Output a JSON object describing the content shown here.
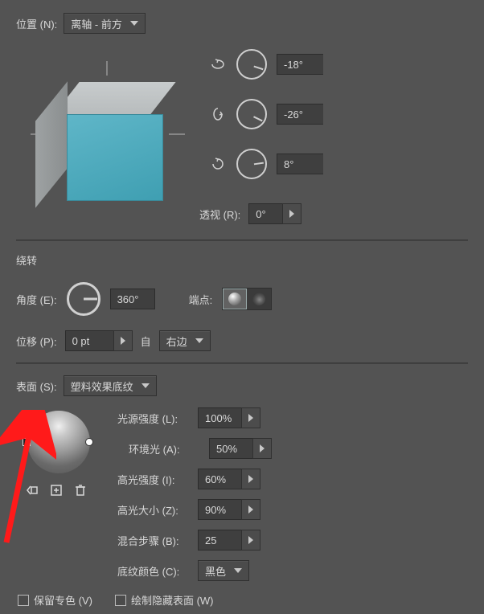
{
  "position": {
    "label": "位置 (N):",
    "preset": "离轴 - 前方",
    "rotations": {
      "rx_value": "-18°",
      "ry_value": "-26°",
      "rz_value": "8°"
    },
    "perspective_label": "透视 (R):",
    "perspective_value": "0°"
  },
  "bevel": {
    "section_title": "绕转",
    "angle_label": "角度 (E):",
    "angle_value": "360°",
    "cap_label": "端点:",
    "offset_label": "位移 (P):",
    "offset_value": "0 pt",
    "from_label": "自",
    "from_value": "右边"
  },
  "surface": {
    "label": "表面 (S):",
    "preset": "塑料效果底纹",
    "light_intensity_label": "光源强度 (L):",
    "light_intensity_value": "100%",
    "ambient_label": "环境光 (A):",
    "ambient_value": "50%",
    "highlight_intensity_label": "高光强度 (I):",
    "highlight_intensity_value": "60%",
    "highlight_size_label": "高光大小 (Z):",
    "highlight_size_value": "90%",
    "blend_steps_label": "混合步骤 (B):",
    "blend_steps_value": "25",
    "shade_color_label": "底纹颜色 (C):",
    "shade_color_value": "黑色"
  },
  "footer": {
    "preserve_spot_label": "保留专色 (V)",
    "draw_hidden_label": "绘制隐藏表面 (W)"
  }
}
